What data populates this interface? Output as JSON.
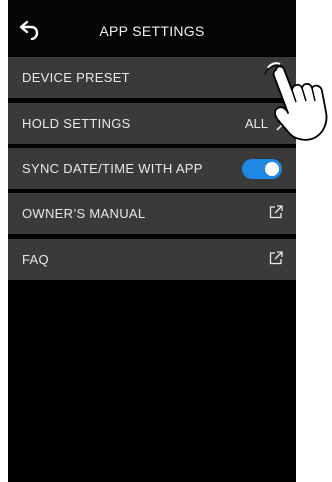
{
  "header": {
    "title": "APP SETTINGS",
    "back_icon": "back-arrow-icon"
  },
  "settings": [
    {
      "label": "DEVICE PRESET",
      "type": "nav"
    },
    {
      "label": "HOLD SETTINGS",
      "type": "value",
      "value": "ALL"
    },
    {
      "label": "SYNC DATE/TIME WITH APP",
      "type": "toggle",
      "enabled": true
    },
    {
      "label": "OWNER’S MANUAL",
      "type": "external",
      "icon": "external-link-icon"
    },
    {
      "label": "FAQ",
      "type": "external",
      "icon": "external-link-icon"
    }
  ],
  "colors": {
    "background": "#000000",
    "row": "#3a3a3a",
    "toggle_on": "#1e88e5",
    "text": "#e9e9e9"
  },
  "annotation_icon": "pointing-hand-icon"
}
